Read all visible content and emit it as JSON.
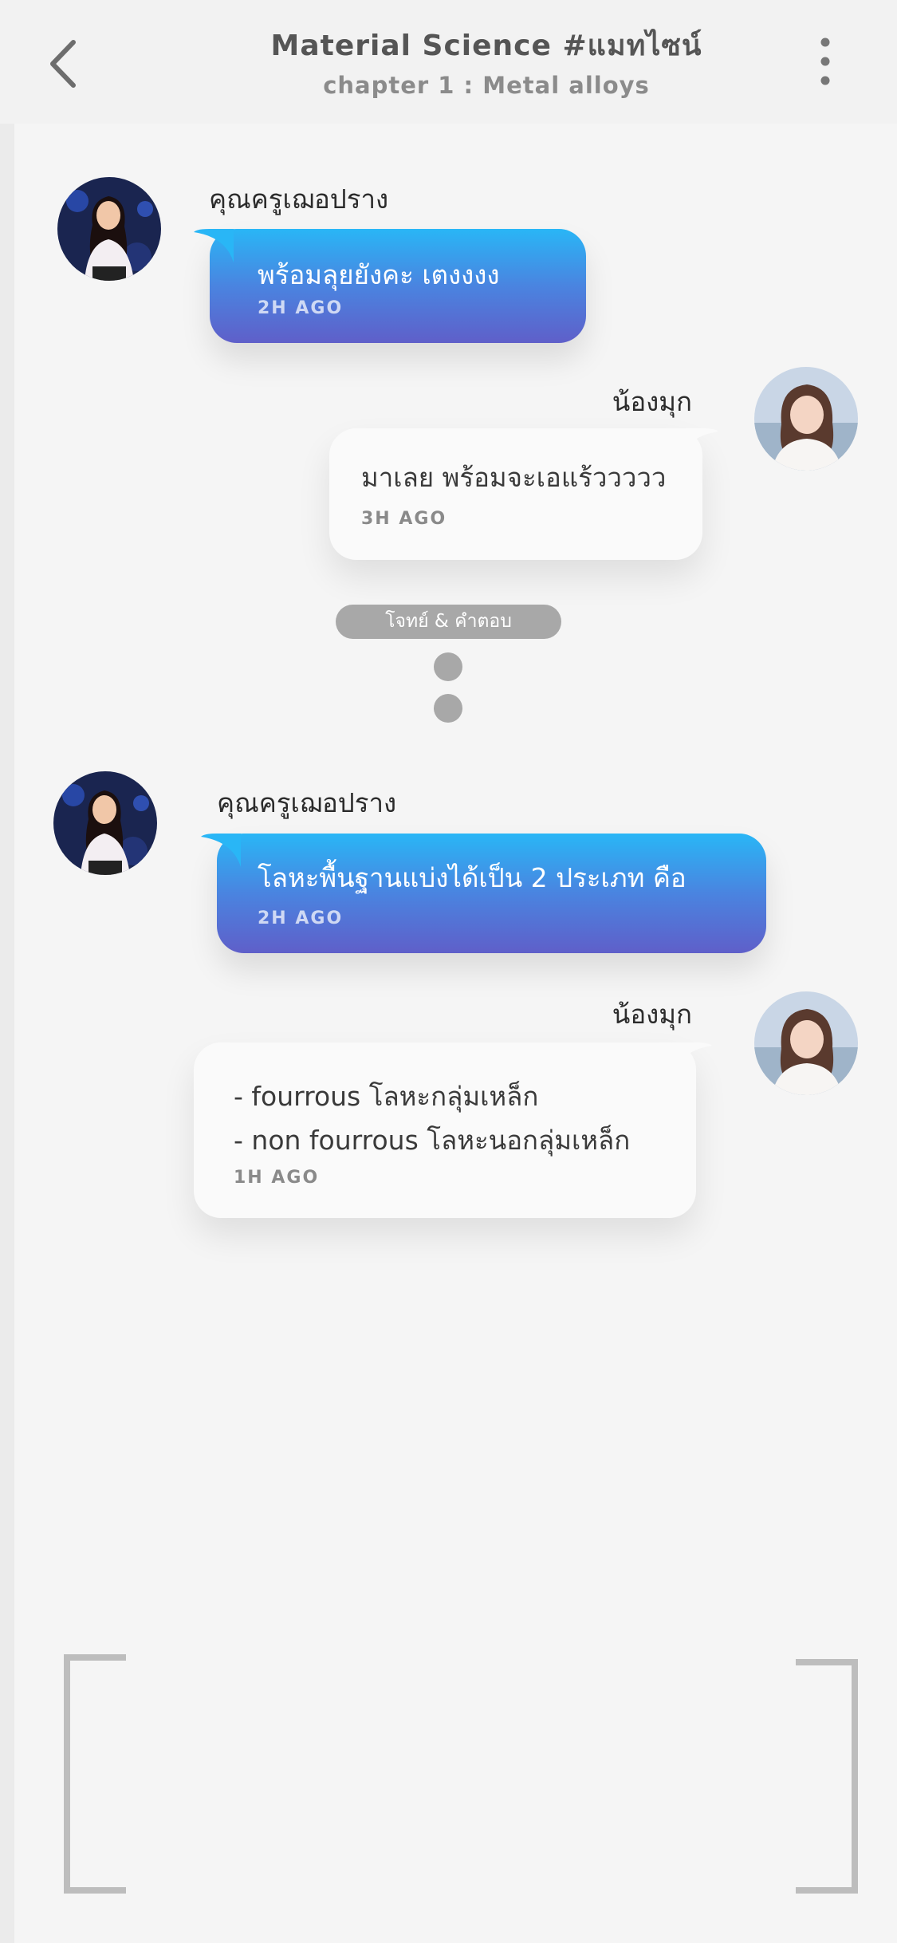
{
  "header": {
    "title": "Material Science #แมทไซน์",
    "subtitle": "chapter 1 : Metal alloys"
  },
  "messages": [
    {
      "sender": "คุณครูเฌอปราง",
      "side": "left",
      "text": "พร้อมลุยยังคะ เตงงงง",
      "time": "2H AGO"
    },
    {
      "sender": "น้องมุก",
      "side": "right",
      "text": "มาเลย พร้อมจะเอแร้ววววว",
      "time": "3H AGO"
    },
    {
      "sender": "คุณครูเฌอปราง",
      "side": "left",
      "text": "โลหะพื้นฐานแบ่งได้เป็น 2 ประเภท คือ",
      "time": "2H AGO"
    },
    {
      "sender": "น้องมุก",
      "side": "right",
      "lines": [
        "- fourrous โลหะกลุ่มเหล็ก",
        "- non fourrous  โลหะนอกลุ่มเหล็ก"
      ],
      "time": "1H AGO"
    }
  ],
  "divider": {
    "label": "โจทย์ & คำตอบ"
  },
  "colors": {
    "bubble_gradient_top": "#29b6f6",
    "bubble_gradient_bottom": "#5f5fc9",
    "pill": "#a8a8a8",
    "background": "#f5f5f5"
  },
  "icons": {
    "back": "chevron-left-icon",
    "more": "more-vertical-icon"
  }
}
